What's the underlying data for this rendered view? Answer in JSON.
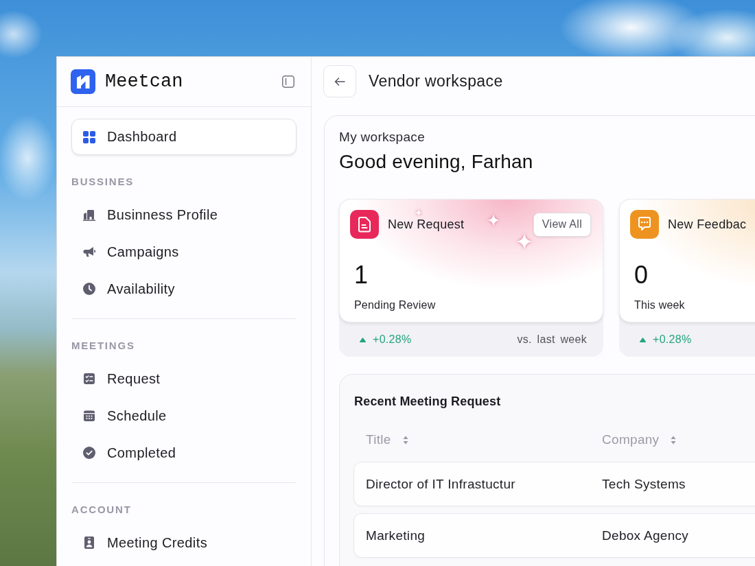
{
  "sidebar": {
    "brand": "Meetcan",
    "items": [
      {
        "label": "Dashboard",
        "selected": true
      }
    ],
    "sections": [
      {
        "heading": "BUSSINES",
        "items": [
          {
            "label": "Businness Profile",
            "selected": false
          },
          {
            "label": "Campaigns",
            "selected": false
          },
          {
            "label": "Availability",
            "selected": false
          }
        ]
      },
      {
        "heading": "MEETINGS",
        "items": [
          {
            "label": "Request",
            "selected": false
          },
          {
            "label": "Schedule",
            "selected": false
          },
          {
            "label": "Completed",
            "selected": false
          }
        ]
      },
      {
        "heading": "ACCOUNT",
        "items": [
          {
            "label": "Meeting Credits",
            "selected": false
          }
        ]
      }
    ]
  },
  "header": {
    "title": "Vendor workspace"
  },
  "workspace": {
    "label": "My workspace",
    "greeting": "Good evening, Farhan",
    "stat_cards": [
      {
        "title": "New Request",
        "action": "View All",
        "color": "#e8285a",
        "sparkles": true,
        "count": "1",
        "caption": "Pending Review",
        "rising": true,
        "change": "+0.28%",
        "comparison": "vs. last week"
      },
      {
        "title": "New Feedbac",
        "color": "#ee9320",
        "sparkles": false,
        "count": "0",
        "caption": "This week",
        "rising": true,
        "change": "+0.28%"
      }
    ],
    "recent_requests": {
      "title": "Recent Meeting Request",
      "columns": [
        {
          "label": "Title"
        },
        {
          "label": "Company"
        }
      ],
      "rows": [
        [
          "Director of IT Infrastuctur",
          "Tech Systems"
        ],
        [
          "Marketing",
          "Debox Agency"
        ]
      ]
    }
  }
}
